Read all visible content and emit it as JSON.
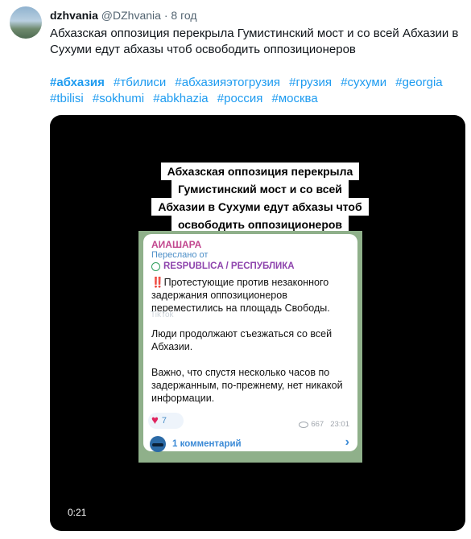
{
  "tweet": {
    "display_name": "dzhvania",
    "handle": "@DZhvania",
    "separator": "·",
    "time": "8 год",
    "text": "Абхазская оппозиция перекрыла Гумистинский мост и со всей Абхазии в Сухуми едут абхазы чтоб освободить оппозиционеров",
    "hashtags": [
      "#абхазия",
      "#тбилиси",
      "#абхазияэтогрузия",
      "#грузия",
      "#сухуми",
      "#georgia",
      "#tbilisi",
      "#sokhumi",
      "#abkhazia",
      "#россия",
      "#москва"
    ]
  },
  "video": {
    "caption_lines": [
      "Абхазская оппозиция перекрыла",
      "Гумистинский мост и со всей",
      "Абхазии в Сухуми едут абхазы чтоб",
      "освободить оппозиционеров"
    ],
    "timer": "0:21",
    "message": {
      "channel_title": "АИАШАРА",
      "forwarded_label": "Переслано от",
      "source": "RESPUBLICA / РЕСПУБЛИКА",
      "exclamation": "‼️",
      "paragraph1": "Протестующие против незаконного задержания оппозиционеров переместились на площадь Свободы.",
      "paragraph2": "Люди продолжают съезжаться со всей Абхазии.",
      "paragraph3": "Важно, что спустя несколько часов по задержанным, по-прежнему, нет никакой информации.",
      "reaction_count": "7",
      "views": "667",
      "time": "23:01",
      "comments_label": "1 комментарий",
      "watermark": "TikTok"
    }
  },
  "colors": {
    "link": "#1d9bf0",
    "channel_title": "#c2478f",
    "source": "#8e44ad",
    "telegram_bg": "#8fb08a"
  },
  "icons": [
    "heart-icon",
    "eye-icon",
    "chevron-right-icon",
    "tiktok-watermark"
  ]
}
